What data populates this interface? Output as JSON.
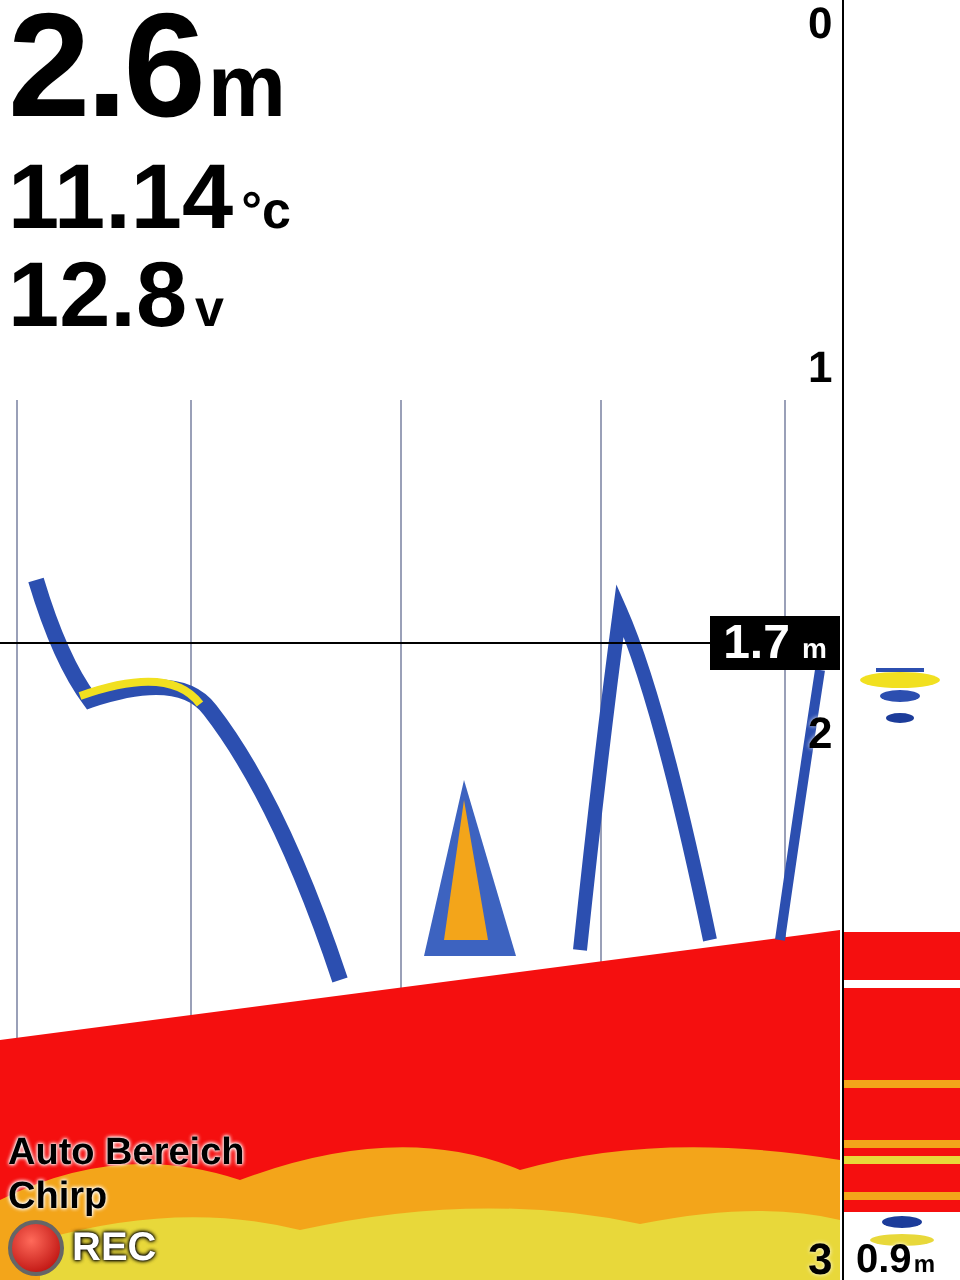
{
  "readouts": [
    {
      "kind": "depth",
      "value": "2.6",
      "unit": "m"
    },
    {
      "kind": "temperature",
      "value": "11.14",
      "unit": "°c"
    },
    {
      "kind": "voltage",
      "value": "12.8",
      "unit": "v"
    }
  ],
  "depth_scale": [
    "0",
    "1",
    "2",
    "3"
  ],
  "depth_marker": {
    "value": "1.7",
    "unit": "m"
  },
  "status_lines": [
    "Auto Bereich",
    "Chirp"
  ],
  "recording": {
    "label": "REC",
    "on": true
  },
  "a_scope": {
    "value": "0.9",
    "unit": "m"
  }
}
